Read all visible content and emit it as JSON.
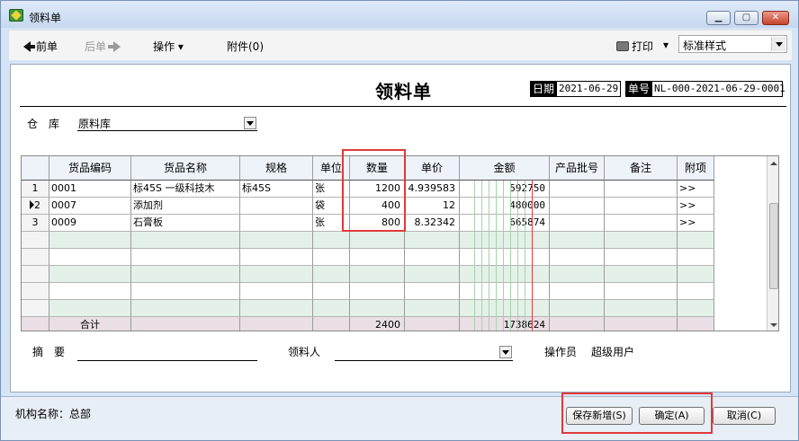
{
  "window": {
    "title": "领料单",
    "min_glyph": "▁",
    "max_glyph": "▢",
    "close_glyph": "✕"
  },
  "toolbar": {
    "prev_label": "前单",
    "next_label": "后单",
    "ops_label": "操作",
    "ops_caret": "▾",
    "attach_label": "附件(0)",
    "print_label": "打印",
    "print_caret": "▾",
    "style_value": "标准样式"
  },
  "form": {
    "title": "领料单",
    "date_label": "日期",
    "date_value": "2021-06-29",
    "no_label": "单号",
    "no_value": "NL-000-2021-06-29-0001",
    "warehouse_label": "仓　库",
    "warehouse_value": "原料库",
    "summary_label": "摘　要",
    "summary_value": "",
    "receiver_label": "领料人",
    "receiver_value": "",
    "operator_label": "操作员",
    "operator_value": "超级用户"
  },
  "grid": {
    "headers": [
      "货品编码",
      "货品名称",
      "规格",
      "单位",
      "数量",
      "单价",
      "金额",
      "产品批号",
      "备注",
      "附项"
    ],
    "rows": [
      {
        "no": "1",
        "code": "0001",
        "name": "标45S 一级科技木",
        "spec": "标45S",
        "unit": "张",
        "qty": "1200",
        "price": "4.939583",
        "amount": "592750",
        "batch": "",
        "note": "",
        "extra": ">>"
      },
      {
        "no": "2",
        "code": "0007",
        "name": "添加剂",
        "spec": "",
        "unit": "袋",
        "qty": "400",
        "price": "12",
        "amount": "480000",
        "batch": "",
        "note": "",
        "extra": ">>"
      },
      {
        "no": "3",
        "code": "0009",
        "name": "石膏板",
        "spec": "",
        "unit": "张",
        "qty": "800",
        "price": "8.32342",
        "amount": "665874",
        "batch": "",
        "note": "",
        "extra": ">>"
      }
    ],
    "total_label": "合计",
    "total_qty": "2400",
    "total_amount": "1738624"
  },
  "status": {
    "org": "机构名称：总部",
    "save_new": "保存新增(S)",
    "ok": "确定(A)",
    "cancel": "取消(C)"
  },
  "colors": {
    "highlight": "#e03a3a",
    "green_row": "#e3f1e9",
    "summary_row": "#e9dfe5"
  }
}
